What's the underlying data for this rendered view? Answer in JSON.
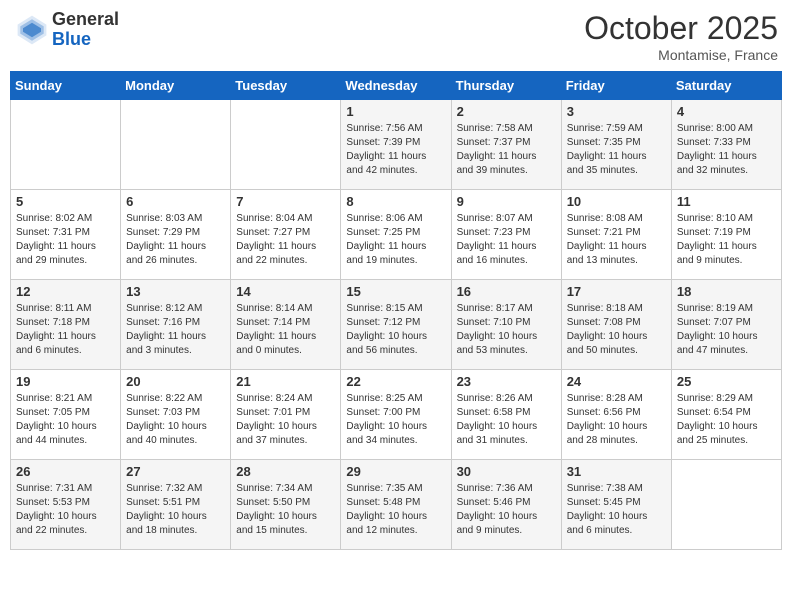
{
  "header": {
    "logo_general": "General",
    "logo_blue": "Blue",
    "month_title": "October 2025",
    "subtitle": "Montamise, France"
  },
  "days_of_week": [
    "Sunday",
    "Monday",
    "Tuesday",
    "Wednesday",
    "Thursday",
    "Friday",
    "Saturday"
  ],
  "weeks": [
    [
      {
        "day": "",
        "info": ""
      },
      {
        "day": "",
        "info": ""
      },
      {
        "day": "",
        "info": ""
      },
      {
        "day": "1",
        "info": "Sunrise: 7:56 AM\nSunset: 7:39 PM\nDaylight: 11 hours\nand 42 minutes."
      },
      {
        "day": "2",
        "info": "Sunrise: 7:58 AM\nSunset: 7:37 PM\nDaylight: 11 hours\nand 39 minutes."
      },
      {
        "day": "3",
        "info": "Sunrise: 7:59 AM\nSunset: 7:35 PM\nDaylight: 11 hours\nand 35 minutes."
      },
      {
        "day": "4",
        "info": "Sunrise: 8:00 AM\nSunset: 7:33 PM\nDaylight: 11 hours\nand 32 minutes."
      }
    ],
    [
      {
        "day": "5",
        "info": "Sunrise: 8:02 AM\nSunset: 7:31 PM\nDaylight: 11 hours\nand 29 minutes."
      },
      {
        "day": "6",
        "info": "Sunrise: 8:03 AM\nSunset: 7:29 PM\nDaylight: 11 hours\nand 26 minutes."
      },
      {
        "day": "7",
        "info": "Sunrise: 8:04 AM\nSunset: 7:27 PM\nDaylight: 11 hours\nand 22 minutes."
      },
      {
        "day": "8",
        "info": "Sunrise: 8:06 AM\nSunset: 7:25 PM\nDaylight: 11 hours\nand 19 minutes."
      },
      {
        "day": "9",
        "info": "Sunrise: 8:07 AM\nSunset: 7:23 PM\nDaylight: 11 hours\nand 16 minutes."
      },
      {
        "day": "10",
        "info": "Sunrise: 8:08 AM\nSunset: 7:21 PM\nDaylight: 11 hours\nand 13 minutes."
      },
      {
        "day": "11",
        "info": "Sunrise: 8:10 AM\nSunset: 7:19 PM\nDaylight: 11 hours\nand 9 minutes."
      }
    ],
    [
      {
        "day": "12",
        "info": "Sunrise: 8:11 AM\nSunset: 7:18 PM\nDaylight: 11 hours\nand 6 minutes."
      },
      {
        "day": "13",
        "info": "Sunrise: 8:12 AM\nSunset: 7:16 PM\nDaylight: 11 hours\nand 3 minutes."
      },
      {
        "day": "14",
        "info": "Sunrise: 8:14 AM\nSunset: 7:14 PM\nDaylight: 11 hours\nand 0 minutes."
      },
      {
        "day": "15",
        "info": "Sunrise: 8:15 AM\nSunset: 7:12 PM\nDaylight: 10 hours\nand 56 minutes."
      },
      {
        "day": "16",
        "info": "Sunrise: 8:17 AM\nSunset: 7:10 PM\nDaylight: 10 hours\nand 53 minutes."
      },
      {
        "day": "17",
        "info": "Sunrise: 8:18 AM\nSunset: 7:08 PM\nDaylight: 10 hours\nand 50 minutes."
      },
      {
        "day": "18",
        "info": "Sunrise: 8:19 AM\nSunset: 7:07 PM\nDaylight: 10 hours\nand 47 minutes."
      }
    ],
    [
      {
        "day": "19",
        "info": "Sunrise: 8:21 AM\nSunset: 7:05 PM\nDaylight: 10 hours\nand 44 minutes."
      },
      {
        "day": "20",
        "info": "Sunrise: 8:22 AM\nSunset: 7:03 PM\nDaylight: 10 hours\nand 40 minutes."
      },
      {
        "day": "21",
        "info": "Sunrise: 8:24 AM\nSunset: 7:01 PM\nDaylight: 10 hours\nand 37 minutes."
      },
      {
        "day": "22",
        "info": "Sunrise: 8:25 AM\nSunset: 7:00 PM\nDaylight: 10 hours\nand 34 minutes."
      },
      {
        "day": "23",
        "info": "Sunrise: 8:26 AM\nSunset: 6:58 PM\nDaylight: 10 hours\nand 31 minutes."
      },
      {
        "day": "24",
        "info": "Sunrise: 8:28 AM\nSunset: 6:56 PM\nDaylight: 10 hours\nand 28 minutes."
      },
      {
        "day": "25",
        "info": "Sunrise: 8:29 AM\nSunset: 6:54 PM\nDaylight: 10 hours\nand 25 minutes."
      }
    ],
    [
      {
        "day": "26",
        "info": "Sunrise: 7:31 AM\nSunset: 5:53 PM\nDaylight: 10 hours\nand 22 minutes."
      },
      {
        "day": "27",
        "info": "Sunrise: 7:32 AM\nSunset: 5:51 PM\nDaylight: 10 hours\nand 18 minutes."
      },
      {
        "day": "28",
        "info": "Sunrise: 7:34 AM\nSunset: 5:50 PM\nDaylight: 10 hours\nand 15 minutes."
      },
      {
        "day": "29",
        "info": "Sunrise: 7:35 AM\nSunset: 5:48 PM\nDaylight: 10 hours\nand 12 minutes."
      },
      {
        "day": "30",
        "info": "Sunrise: 7:36 AM\nSunset: 5:46 PM\nDaylight: 10 hours\nand 9 minutes."
      },
      {
        "day": "31",
        "info": "Sunrise: 7:38 AM\nSunset: 5:45 PM\nDaylight: 10 hours\nand 6 minutes."
      },
      {
        "day": "",
        "info": ""
      }
    ]
  ]
}
